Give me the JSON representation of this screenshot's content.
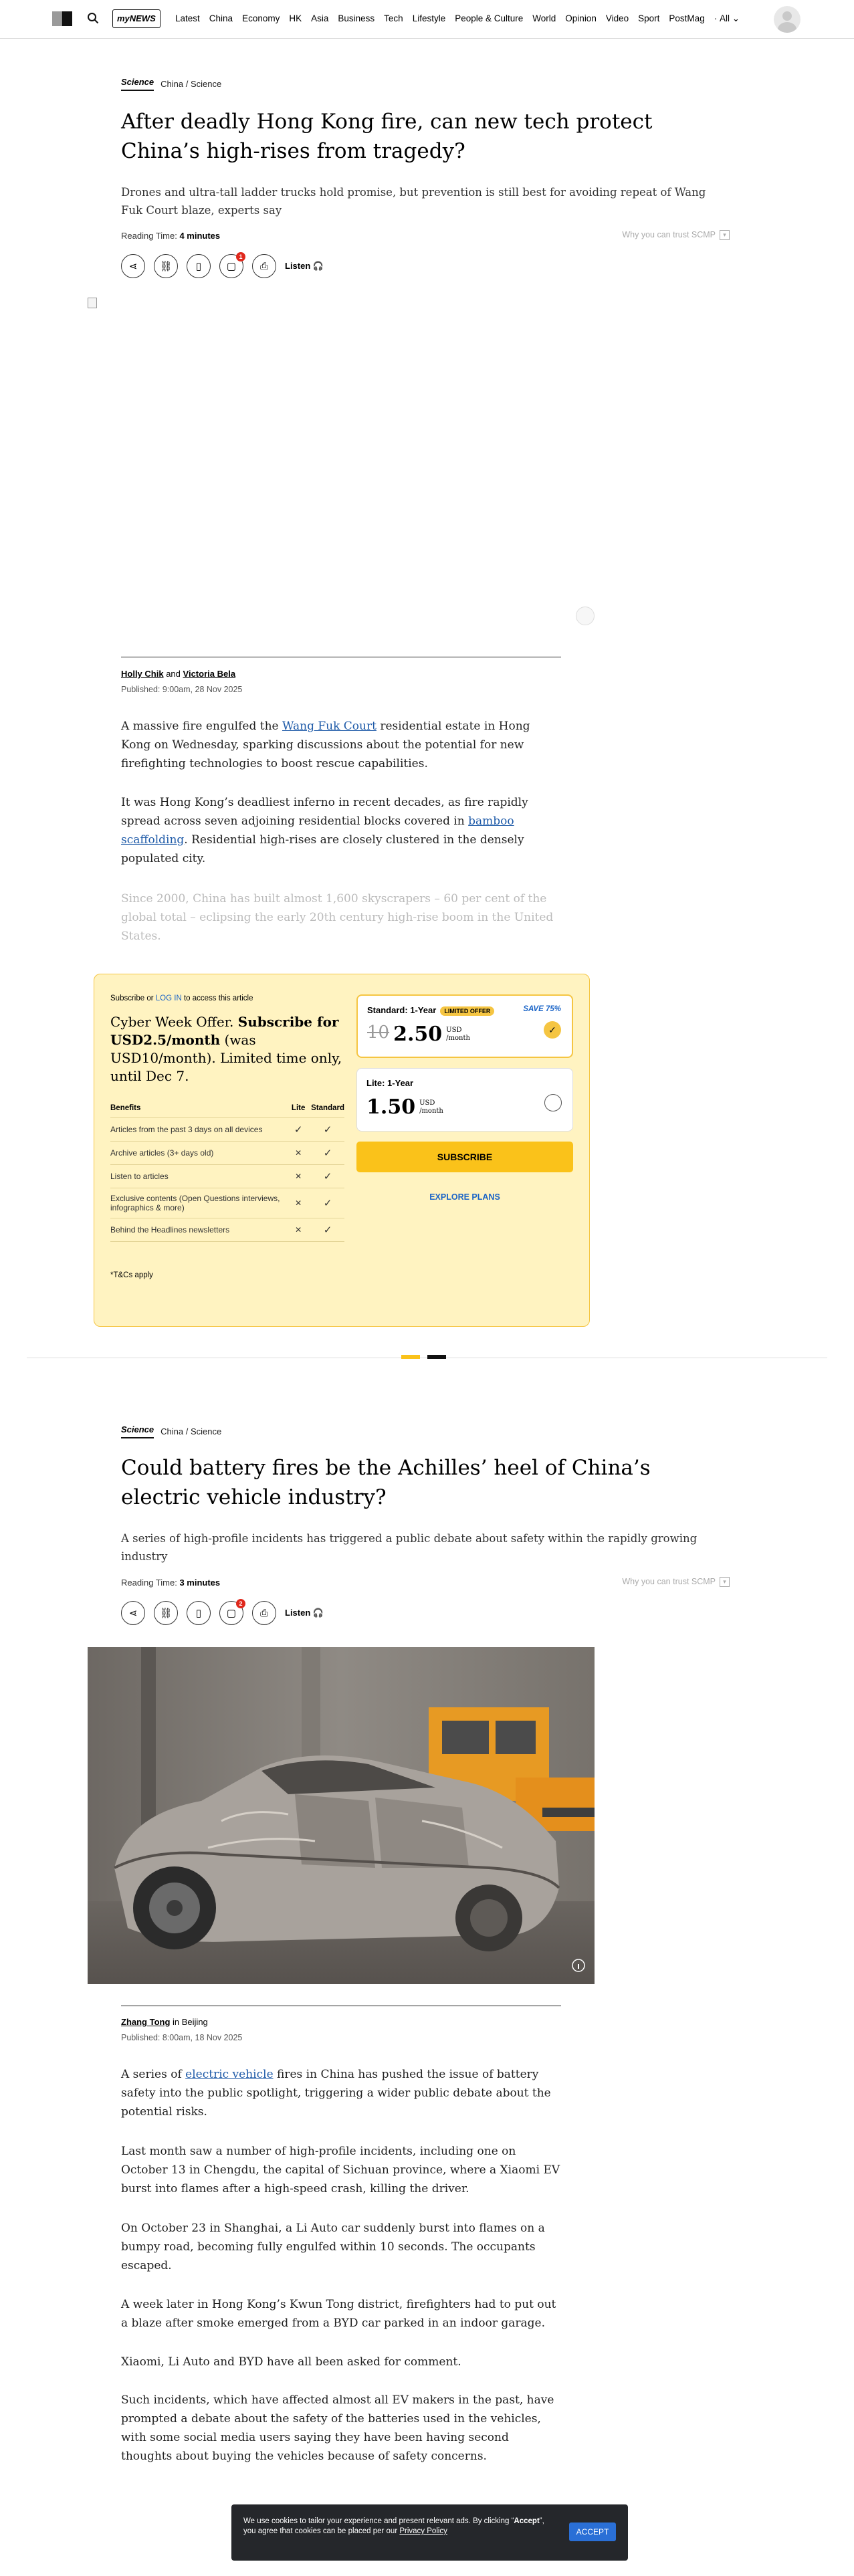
{
  "header": {
    "mynews": "myNEWS",
    "nav": [
      "Latest",
      "China",
      "Economy",
      "HK",
      "Asia",
      "Business",
      "Tech",
      "Lifestyle",
      "People & Culture",
      "World",
      "Opinion",
      "Video",
      "Sport",
      "PostMag",
      "All"
    ]
  },
  "article1": {
    "section": "Science",
    "crumb": "China / Science",
    "headline": "After deadly Hong Kong fire, can new tech protect China’s high-rises from tragedy?",
    "dek": "Drones and ultra-tall ladder trucks hold promise, but prevention is still best for avoiding repeat of Wang Fuk Court blaze, experts say",
    "reading_label": "Reading Time:",
    "reading_value": "4 minutes",
    "trust": "Why you can trust SCMP",
    "listen": "Listen",
    "comment_count": "1",
    "author1": "Holly Chik",
    "and": "and",
    "author2": "Victoria Bela",
    "published": "Published: 9:00am, 28 Nov 2025",
    "p1_a": "A massive fire engulfed the ",
    "p1_link": "Wang Fuk Court",
    "p1_b": " residential estate in Hong Kong on Wednesday, sparking discussions about the potential for new firefighting technologies to boost rescue capabilities.",
    "p2_a": "It was Hong Kong’s deadliest inferno in recent decades, as fire rapidly spread across seven adjoining residential blocks covered in ",
    "p2_link": "bamboo scaffolding",
    "p2_b": ". Residential high-rises are closely clustered in the densely populated city.",
    "p3": "Since 2000, China has built almost 1,600 skyscrapers – 60 per cent of the global total – eclipsing the early 20th century high-rise boom in the United States."
  },
  "paywall": {
    "sub_a": "Subscribe or ",
    "login": "LOG IN",
    "sub_b": " to access this article",
    "offer_a": "Cyber Week Offer. ",
    "offer_b": "Subscribe for USD2.5/month",
    "offer_c": " (was USD10/month). Limited time only, until Dec 7.",
    "headers": [
      "Benefits",
      "Lite",
      "Standard"
    ],
    "benefits": [
      {
        "name": "Articles from the past 3 days on all devices",
        "lite": true,
        "standard": true
      },
      {
        "name": "Archive articles (3+ days old)",
        "lite": false,
        "standard": true
      },
      {
        "name": "Listen to articles",
        "lite": false,
        "standard": true
      },
      {
        "name": "Exclusive contents (Open Questions interviews, infographics & more)",
        "lite": false,
        "standard": true
      },
      {
        "name": "Behind the Headlines newsletters",
        "lite": false,
        "standard": true
      }
    ],
    "tnc": "*T&Cs apply",
    "standard_title": "Standard: 1-Year",
    "limited": "LIMITED OFFER",
    "save": "SAVE 75%",
    "standard_old": "10",
    "standard_price": "2.50",
    "currency": "USD",
    "per": "/month",
    "lite_title": "Lite: 1-Year",
    "lite_price": "1.50",
    "subscribe": "SUBSCRIBE",
    "explore": "EXPLORE PLANS"
  },
  "article2": {
    "section": "Science",
    "crumb": "China / Science",
    "headline": "Could battery fires be the Achilles’ heel of China’s electric vehicle industry?",
    "dek": "A series of high-profile incidents has triggered a public debate about safety within the rapidly growing industry",
    "reading_label": "Reading Time:",
    "reading_value": "3 minutes",
    "trust": "Why you can trust SCMP",
    "listen": "Listen",
    "comment_count": "2",
    "author": "Zhang Tong",
    "location": " in Beijing",
    "published": "Published: 8:00am, 18 Nov 2025",
    "p1_a": "A series of ",
    "p1_link": "electric vehicle",
    "p1_b": " fires in China has pushed the issue of battery safety into the public spotlight, triggering a wider public debate about the potential risks.",
    "p2": "Last month saw a number of high-profile incidents, including one on October 13 in Chengdu, the capital of Sichuan province, where a Xiaomi EV burst into flames after a high-speed crash, killing the driver.",
    "p3": "On October 23 in Shanghai, a Li Auto car suddenly burst into flames on a bumpy road, becoming fully engulfed within 10 seconds. The occupants escaped.",
    "p4": "A week later in Hong Kong’s Kwun Tong district, firefighters had to put out a blaze after smoke emerged from a BYD car parked in an indoor garage.",
    "p5": "Xiaomi, Li Auto and BYD have all been asked for comment.",
    "p6": "Such incidents, which have affected almost all EV makers in the past, have prompted a debate about the safety of the batteries used in the vehicles, with some social media users saying they have been having second thoughts about buying the vehicles because of safety concerns."
  },
  "cookie": {
    "text_a": "We use cookies to tailor your experience and present relevant ads. By clicking “",
    "accept_word": "Accept",
    "text_b": "”, you agree that cookies can be placed per our ",
    "policy": "Privacy Policy",
    "accept": "ACCEPT"
  },
  "colors": {
    "accent": "#fac21a",
    "link": "#1a64c7",
    "paywall_bg": "#fff3c1",
    "cookie_bg": "#25272b"
  }
}
